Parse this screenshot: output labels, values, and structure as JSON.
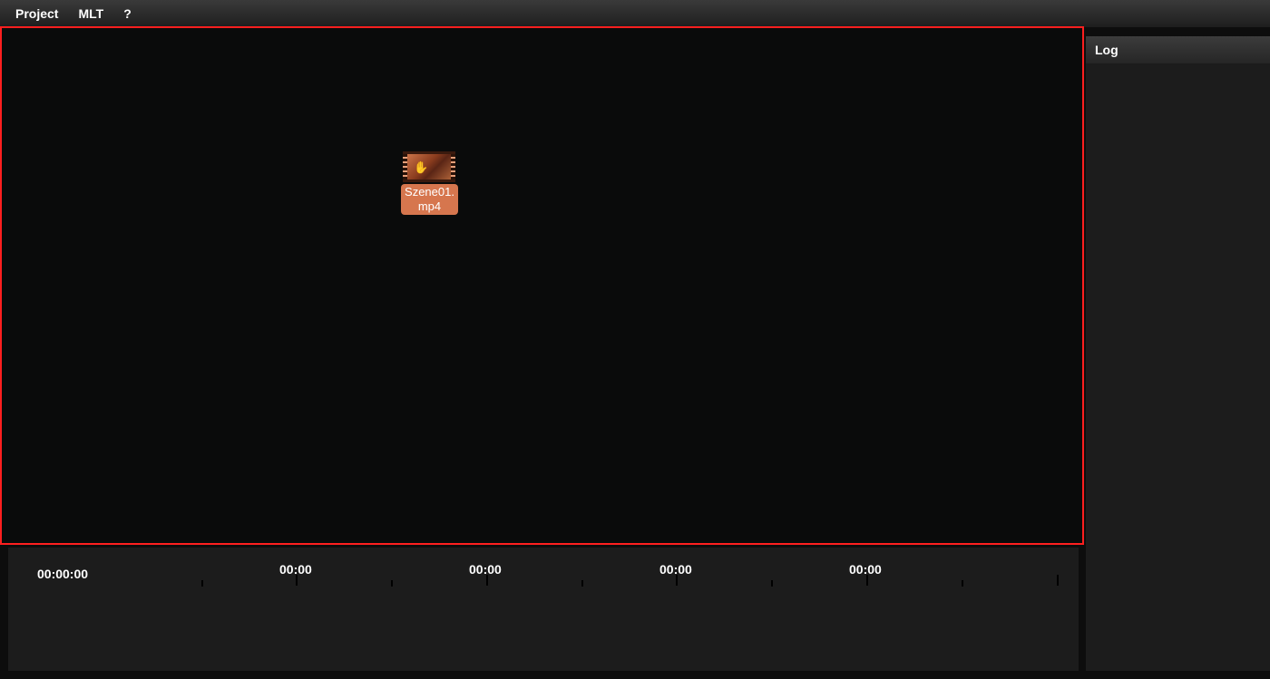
{
  "menubar": {
    "items": [
      "Project",
      "MLT",
      "?"
    ]
  },
  "workspace": {
    "clip": {
      "label": "Szene01.\nmp4",
      "label_line1": "Szene01.",
      "label_line2": "mp4",
      "icon": "video-file-icon"
    }
  },
  "log": {
    "title": "Log"
  },
  "timeline": {
    "start_time": "00:00:00",
    "markers": [
      "00:00",
      "00:00",
      "00:00",
      "00:00"
    ]
  },
  "colors": {
    "selection_border": "#ff1f1f",
    "clip_label": "#d6764e"
  }
}
